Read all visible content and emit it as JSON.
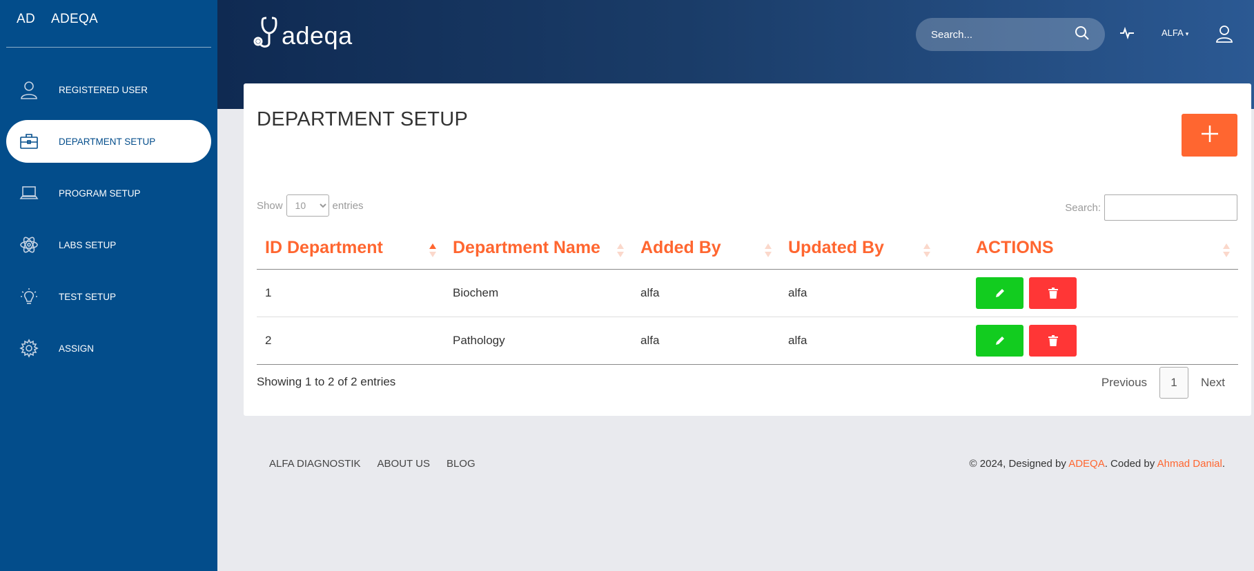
{
  "sidebar": {
    "brand_mini": "AD",
    "brand_name": "ADEQA",
    "items": [
      {
        "label": "REGISTERED USER",
        "icon": "user-icon"
      },
      {
        "label": "DEPARTMENT SETUP",
        "icon": "briefcase-icon",
        "active": true
      },
      {
        "label": "PROGRAM SETUP",
        "icon": "laptop-icon"
      },
      {
        "label": "LABS SETUP",
        "icon": "atom-icon"
      },
      {
        "label": "TEST SETUP",
        "icon": "lightbulb-icon"
      },
      {
        "label": "ASSIGN",
        "icon": "gear-icon"
      }
    ]
  },
  "header": {
    "logo_text": "adeqa",
    "search_placeholder": "Search...",
    "user_name": "ALFA"
  },
  "page": {
    "title": "DEPARTMENT SETUP",
    "add_button_icon": "plus-icon"
  },
  "table_controls": {
    "show_label": "Show",
    "page_size": "10",
    "entries_label": "entries",
    "search_label": "Search:"
  },
  "table": {
    "columns": [
      "ID Department",
      "Department Name",
      "Added By",
      "Updated By",
      "ACTIONS"
    ],
    "rows": [
      [
        "1",
        "Biochem",
        "alfa",
        "alfa"
      ],
      [
        "2",
        "Pathology",
        "alfa",
        "alfa"
      ]
    ]
  },
  "pagination": {
    "info": "Showing 1 to 2 of 2 entries",
    "previous": "Previous",
    "current": "1",
    "next": "Next"
  },
  "footer": {
    "links": [
      "ALFA DIAGNOSTIK",
      "ABOUT US",
      "BLOG"
    ],
    "copyright_prefix": "© 2024, Designed by ",
    "designer": "ADEQA",
    "coded_by": ". Coded by ",
    "coder": "Ahmad Danial",
    "suffix": "."
  },
  "colors": {
    "sidebar": "#034d8b",
    "accent": "#ff6630",
    "edit": "#12cc1f",
    "delete": "#ff3636"
  }
}
